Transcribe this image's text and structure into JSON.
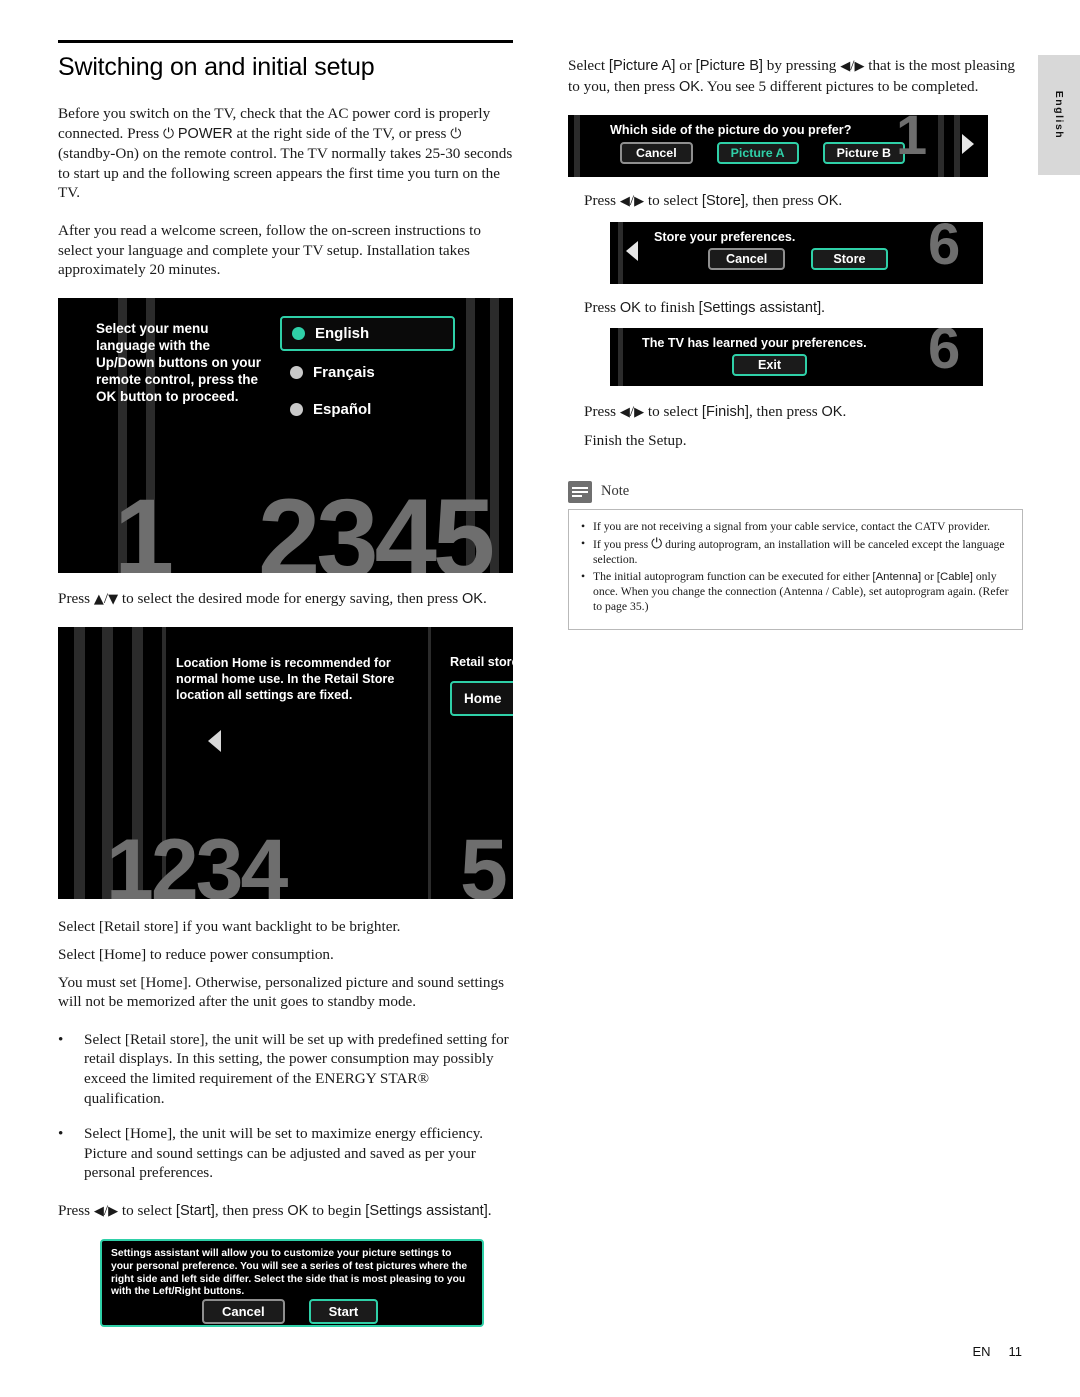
{
  "page": {
    "title": "Switching on and initial setup",
    "side_tab": "English",
    "footer_code": "EN",
    "footer_page": "11"
  },
  "left": {
    "para1": "Before you switch on the TV, check that the AC power cord is properly connected. Press ⏻ POWER at the right side of the TV, or press ⏻ (standby-On) on the remote control. The TV normally takes 25-30 seconds to start up and the following screen appears the first time you turn on the TV.",
    "para2": "After you read a welcome screen, follow the on-screen instructions to select your language and complete your TV setup. Installation takes approximately 20 minutes.",
    "language_screen": {
      "instruction": "Select your menu language with the Up/Down buttons on your remote control, press the OK button to proceed.",
      "options": [
        "English",
        "Français",
        "Español"
      ],
      "selected": "English",
      "step_digits": "2345",
      "step_current": "1"
    },
    "para3": "Press ▲/▼ to select the desired mode for energy saving, then press OK.",
    "location_screen": {
      "message": "Location Home is recommended for normal home use. In the Retail Store location all settings are fixed.",
      "retail_label": "Retail store",
      "home_label": "Home",
      "step_digits": "1234",
      "step_current": "5"
    },
    "para4": "Select [Retail store] if you want backlight to be brighter.",
    "para5": "Select [Home] to reduce power consumption.",
    "para6": "You must set [Home]. Otherwise, personalized picture and sound settings will not be memorized after the unit goes to standby mode.",
    "bullets": [
      "Select [Retail store], the unit will be set up with predefined setting for retail displays. In this setting, the power consumption may possibly exceed the limited requirement of the ENERGY STAR® qualification.",
      "Select [Home], the unit will be set to maximize energy efficiency. Picture and sound settings can be adjusted and saved as per your personal preferences."
    ],
    "para7": "Press ◀/▶ to select [Start], then press OK to begin [Settings assistant].",
    "assistant_screen": {
      "message": "Settings assistant will allow you to customize your picture settings to your personal preference. You will see a series of test pictures where the right side and left side differ. Select the side that is most pleasing to you with the Left/Right buttons.",
      "cancel_label": "Cancel",
      "start_label": "Start"
    }
  },
  "right": {
    "para1": "Select [Picture A] or [Picture B] by pressing ◀/▶ that is the most pleasing to you, then press OK. You see 5 different pictures to be completed.",
    "prefer_screen": {
      "question": "Which side of the picture do you prefer?",
      "cancel_label": "Cancel",
      "picture_a_label": "Picture A",
      "picture_b_label": "Picture B",
      "step_current": "1"
    },
    "para2": "Press ◀/▶ to select [Store], then press OK.",
    "store_screen": {
      "question": "Store your preferences.",
      "cancel_label": "Cancel",
      "store_label": "Store",
      "step_current": "6"
    },
    "para3": "Press OK to finish [Settings assistant].",
    "learned_screen": {
      "message": "The TV has learned your preferences.",
      "exit_label": "Exit",
      "step_current": "6"
    },
    "para4": "Press ◀/▶ to select [Finish], then press OK.",
    "para5": "Finish the Setup.",
    "note": {
      "label": "Note",
      "items": [
        "If you are not receiving a signal from your cable service, contact the CATV provider.",
        "If you press ⏻ during autoprogram, an installation will be canceled except the language selection.",
        "The initial autoprogram function can be executed for either [Antenna] or [Cable] only once. When you change the connection (Antenna / Cable), set autoprogram again. (Refer to page 35.)"
      ]
    }
  },
  "colors": {
    "accent_green": "#2fd0a8",
    "screen_black": "#000000",
    "digit_gray": "#6e6e6e"
  }
}
